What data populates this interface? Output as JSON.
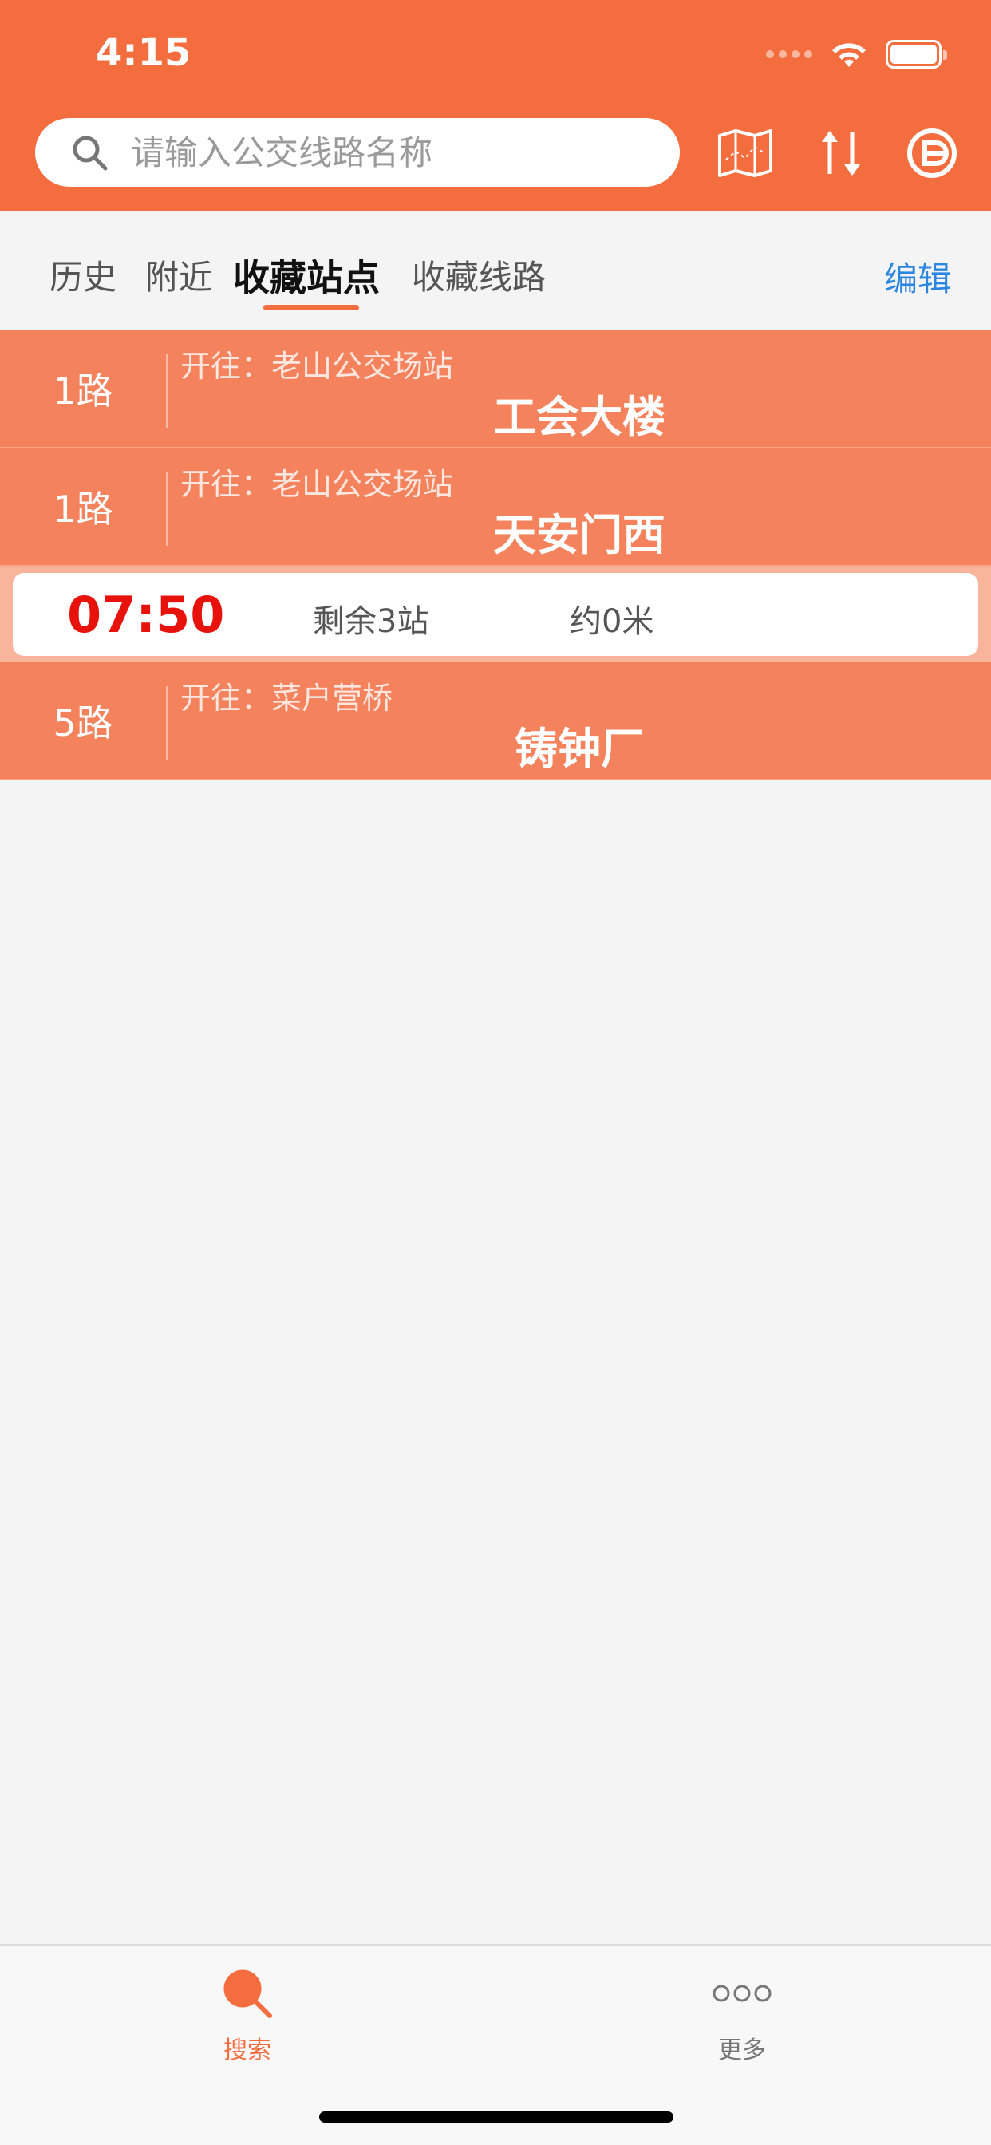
{
  "status_bar": {
    "time": "4:15"
  },
  "search": {
    "placeholder": "请输入公交线路名称"
  },
  "header_icons": [
    "map-icon",
    "swap-icon",
    "beijing-logo-icon"
  ],
  "tabs": [
    {
      "label": "历史",
      "active": false
    },
    {
      "label": "附近",
      "active": false
    },
    {
      "label": "收藏站点",
      "active": true
    },
    {
      "label": "收藏线路",
      "active": false
    }
  ],
  "edit_label": "编辑",
  "favorites": [
    {
      "line": "1路",
      "toward": "开往：老山公交场站",
      "stop": "工会大楼"
    },
    {
      "line": "1路",
      "toward": "开往：老山公交场站",
      "stop": "天安门西"
    },
    {
      "line": "5路",
      "toward": "开往：菜户营桥",
      "stop": "铸钟厂"
    }
  ],
  "arrival": {
    "time": "07:50",
    "remaining": "剩余3站",
    "distance": "约0米"
  },
  "tabbar": [
    {
      "label": "搜索",
      "icon": "search-icon",
      "active": true
    },
    {
      "label": "更多",
      "icon": "more-icon",
      "active": false
    }
  ],
  "colors": {
    "brand": "#f46d3f",
    "row": "#f4825d",
    "arrival_time": "#e8120c",
    "edit": "#2a86e0"
  }
}
